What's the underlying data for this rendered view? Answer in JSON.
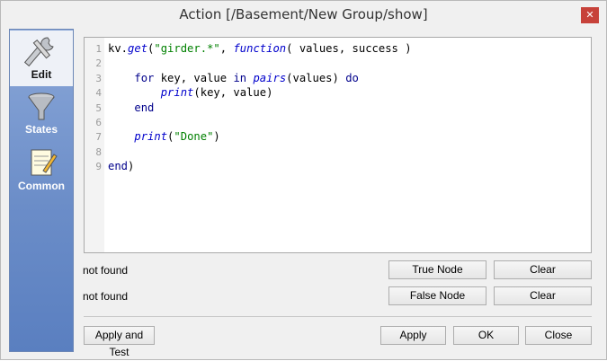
{
  "window": {
    "title": "Action [/Basement/New Group/show]",
    "close_glyph": "✕"
  },
  "sidebar": {
    "items": [
      {
        "label": "Edit",
        "icon": "wrench-icon",
        "active": true
      },
      {
        "label": "States",
        "icon": "funnel-icon",
        "active": false
      },
      {
        "label": "Common",
        "icon": "notepad-icon",
        "active": false
      }
    ]
  },
  "editor": {
    "line_numbers": [
      "1",
      "2",
      "3",
      "4",
      "5",
      "6",
      "7",
      "8",
      "9"
    ],
    "lines": [
      [
        {
          "t": "kv.",
          "c": ""
        },
        {
          "t": "get",
          "c": "fn"
        },
        {
          "t": "(",
          "c": ""
        },
        {
          "t": "\"girder.*\"",
          "c": "str"
        },
        {
          "t": ", ",
          "c": ""
        },
        {
          "t": "function",
          "c": "fn"
        },
        {
          "t": "( values, success )",
          "c": ""
        }
      ],
      [],
      [
        {
          "t": "    ",
          "c": ""
        },
        {
          "t": "for",
          "c": "kw"
        },
        {
          "t": " key, value ",
          "c": ""
        },
        {
          "t": "in",
          "c": "kw"
        },
        {
          "t": " ",
          "c": ""
        },
        {
          "t": "pairs",
          "c": "fn"
        },
        {
          "t": "(values) ",
          "c": ""
        },
        {
          "t": "do",
          "c": "kw"
        }
      ],
      [
        {
          "t": "        ",
          "c": ""
        },
        {
          "t": "print",
          "c": "fn"
        },
        {
          "t": "(key, value)",
          "c": ""
        }
      ],
      [
        {
          "t": "    ",
          "c": ""
        },
        {
          "t": "end",
          "c": "kw"
        }
      ],
      [],
      [
        {
          "t": "    ",
          "c": ""
        },
        {
          "t": "print",
          "c": "fn"
        },
        {
          "t": "(",
          "c": ""
        },
        {
          "t": "\"Done\"",
          "c": "str"
        },
        {
          "t": ")",
          "c": ""
        }
      ],
      [],
      [
        {
          "t": "end",
          "c": "kw"
        },
        {
          "t": ")",
          "c": ""
        }
      ]
    ]
  },
  "true_node": {
    "status": "not found",
    "button": "True Node",
    "clear": "Clear"
  },
  "false_node": {
    "status": "not found",
    "button": "False Node",
    "clear": "Clear"
  },
  "footer": {
    "apply_test": "Apply and Test",
    "apply": "Apply",
    "ok": "OK",
    "close": "Close"
  }
}
